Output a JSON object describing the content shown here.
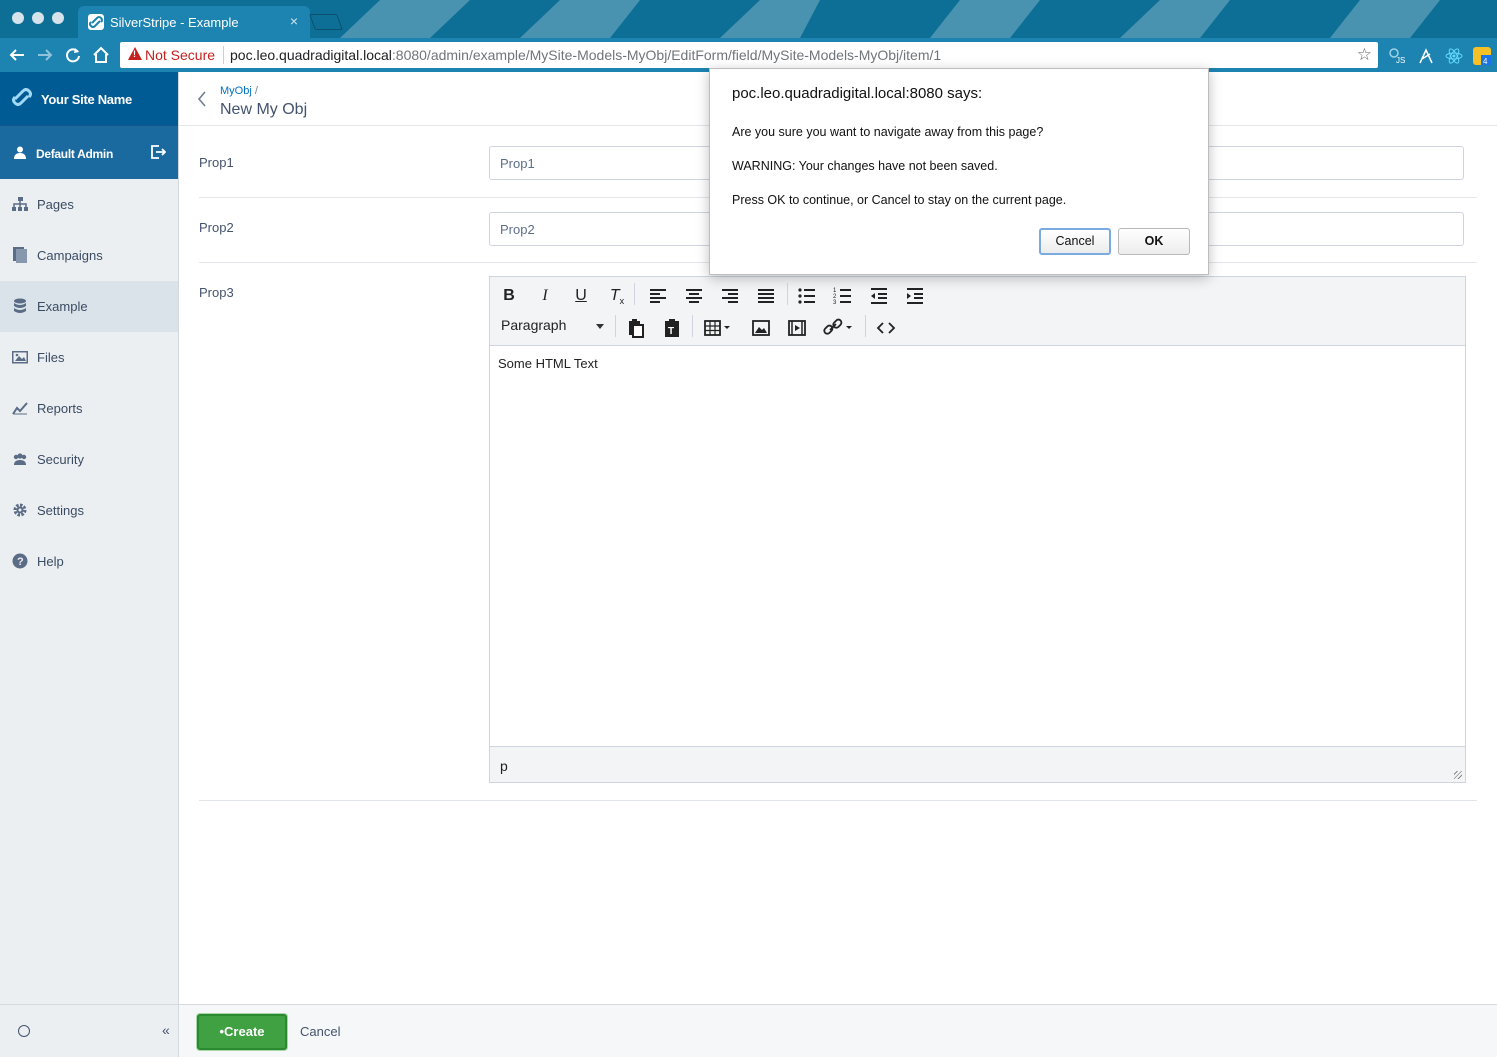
{
  "browser": {
    "tab_title": "SilverStripe - Example",
    "tab_close": "×",
    "not_secure": "Not Secure",
    "url_host": "poc.leo.quadradigital.local",
    "url_rest": ":8080/admin/example/MySite-Models-MyObj/EditForm/field/MySite-Models-MyObj/item/1"
  },
  "sidebar": {
    "site_name": "Your Site Name",
    "user_name": "Default Admin",
    "items": [
      {
        "label": "Pages",
        "icon": "sitemap-icon"
      },
      {
        "label": "Campaigns",
        "icon": "file-icon"
      },
      {
        "label": "Example",
        "icon": "database-icon"
      },
      {
        "label": "Files",
        "icon": "image-icon"
      },
      {
        "label": "Reports",
        "icon": "chart-line-icon"
      },
      {
        "label": "Security",
        "icon": "users-icon"
      },
      {
        "label": "Settings",
        "icon": "gear-icon"
      },
      {
        "label": "Help",
        "icon": "help-icon"
      }
    ],
    "collapse": "«"
  },
  "header": {
    "breadcrumb_link": "MyObj",
    "breadcrumb_sep": "/",
    "title": "New My Obj"
  },
  "form": {
    "prop1_label": "Prop1",
    "prop1_placeholder": "Prop1",
    "prop2_label": "Prop2",
    "prop2_placeholder": "Prop2",
    "prop3_label": "Prop3",
    "editor": {
      "block_format": "Paragraph",
      "content": "Some HTML Text",
      "status_path": "p"
    }
  },
  "actions": {
    "create_label": "Create",
    "cancel_label": "Cancel"
  },
  "dialog": {
    "title": "poc.leo.quadradigital.local:8080 says:",
    "line1": "Are you sure you want to navigate away from this page?",
    "line2": "WARNING: Your changes have not been saved.",
    "line3": "Press OK to continue, or Cancel to stay on the current page.",
    "cancel_label": "Cancel",
    "ok_label": "OK"
  },
  "colors": {
    "brand": "#005b94",
    "user_bar": "#1a6aa0",
    "create_button": "#3fa142",
    "not_secure": "#c5221f"
  }
}
